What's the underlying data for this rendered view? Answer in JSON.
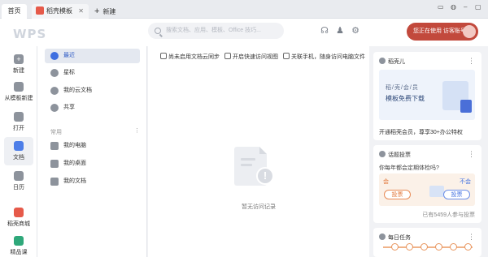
{
  "tabs": {
    "home": "首页",
    "template": "稻壳模板",
    "new": "新建"
  },
  "header": {
    "logo": "WPS",
    "search_placeholder": "搜索文档、应用、模板、Office 技巧..."
  },
  "user": {
    "status": "您正在使用 访客账号"
  },
  "rail": [
    {
      "label": "新建",
      "icon": "plus-icon"
    },
    {
      "label": "从模板新建",
      "icon": "template-icon"
    },
    {
      "label": "打开",
      "icon": "folder-icon"
    },
    {
      "label": "文档",
      "icon": "document-icon"
    },
    {
      "label": "日历",
      "icon": "calendar-icon"
    },
    {
      "label": "稻壳商城",
      "icon": "store-icon"
    },
    {
      "label": "精品课",
      "icon": "course-icon"
    }
  ],
  "sidebar": {
    "items": [
      "最近",
      "星标",
      "我的云文档",
      "共享"
    ],
    "section_common": "常用",
    "common_items": [
      "我的电脑",
      "我的桌面",
      "我的文档"
    ]
  },
  "main": {
    "quick": [
      "尚未启用文档云同步",
      "开启快速访问视图",
      "关联手机，随身访问电脑文件"
    ],
    "empty_text": "暂无访问记录"
  },
  "cards": {
    "daoke": {
      "title": "稻壳儿",
      "banner_line1": "稻/壳/会/员",
      "banner_line2": "模板免费下载",
      "foot": "开通稻壳会员，尊享30+办公特权"
    },
    "vote": {
      "title": "话题投票",
      "question": "你每年都会定期体检吗?",
      "yes_label": "会",
      "no_label": "不会",
      "yes_button": "投票",
      "no_button": "投票",
      "stat": "已有5459人参与投票"
    },
    "task": {
      "title": "每日任务"
    }
  },
  "colors": {
    "accent": "#3f6fe0",
    "user_pill": "#c2493c"
  }
}
